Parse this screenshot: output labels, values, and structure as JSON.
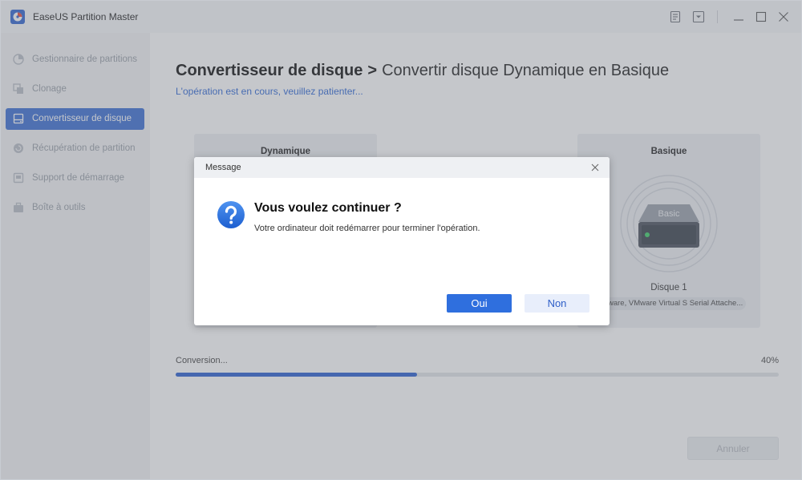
{
  "app": {
    "title": "EaseUS Partition Master",
    "accent": "#3b6fd4"
  },
  "sidebar": {
    "items": [
      {
        "label": "Gestionnaire de partitions",
        "icon": "partition-manager-icon",
        "active": false
      },
      {
        "label": "Clonage",
        "icon": "clone-icon",
        "active": false
      },
      {
        "label": "Convertisseur de disque",
        "icon": "disk-converter-icon",
        "active": true
      },
      {
        "label": "Récupération de partition",
        "icon": "partition-recovery-icon",
        "active": false
      },
      {
        "label": "Support de démarrage",
        "icon": "boot-media-icon",
        "active": false
      },
      {
        "label": "Boîte à outils",
        "icon": "toolbox-icon",
        "active": false
      }
    ]
  },
  "main": {
    "heading_main": "Convertisseur de disque",
    "heading_sep": ">",
    "heading_sub": "Convertir disque Dynamique en Basique",
    "status_line": "L'opération est en cours, veuillez patienter...",
    "source_panel": {
      "title": "Dynamique"
    },
    "target_panel": {
      "title": "Basique",
      "disk_badge": "Basic",
      "disk_name": "Disque 1",
      "disk_model": "VMware, VMware Virtual S Serial Attache..."
    },
    "progress": {
      "label": "Conversion...",
      "percent_text": "40%",
      "value": 0.4
    },
    "cancel_label": "Annuler"
  },
  "dialog": {
    "title": "Message",
    "heading": "Vous voulez continuer ?",
    "text": "Votre ordinateur doit redémarrer pour terminer l'opération.",
    "yes_label": "Oui",
    "no_label": "Non"
  }
}
